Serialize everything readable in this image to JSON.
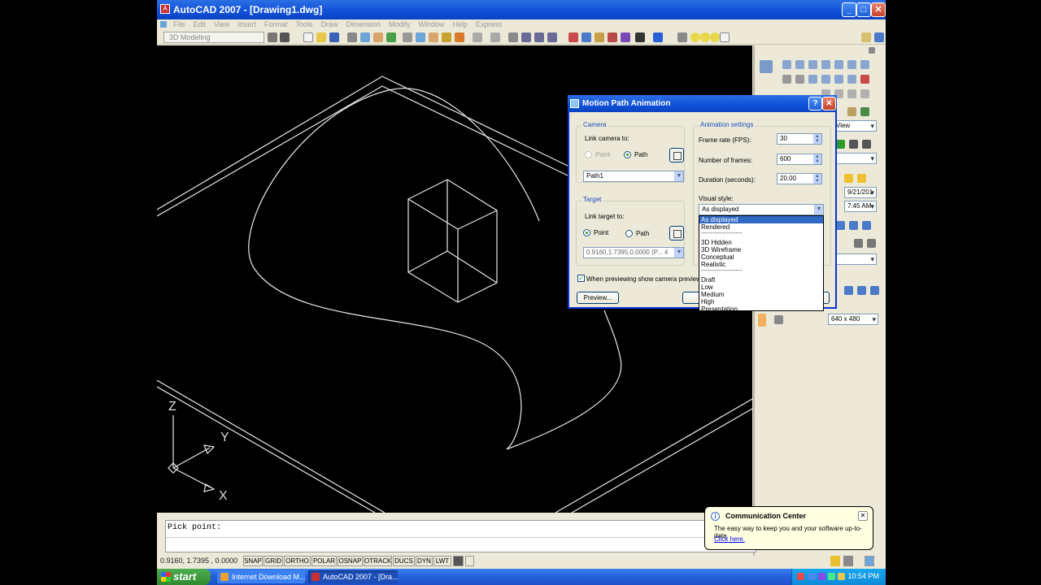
{
  "window": {
    "title": "AutoCAD 2007 - [Drawing1.dwg]"
  },
  "menubar": {
    "items": [
      "File",
      "Edit",
      "View",
      "Insert",
      "Format",
      "Tools",
      "Draw",
      "Dimension",
      "Modify",
      "Window",
      "Help",
      "Express"
    ]
  },
  "toolbar": {
    "workspace": "3D Modeling"
  },
  "viewport": {
    "ucs_x": "X",
    "ucs_y": "Y",
    "ucs_z": "Z"
  },
  "command_line": {
    "prompt": "Pick point:"
  },
  "status_bar": {
    "coordinates": "0.9160, 1.7395 , 0.0000",
    "toggles": [
      "SNAP",
      "GRID",
      "ORTHO",
      "POLAR",
      "OSNAP",
      "OTRACK",
      "DUCS",
      "DYN",
      "LWT"
    ]
  },
  "palette": {
    "view_select": "View",
    "date": "9/21/201",
    "time": "7:45 AM",
    "resolution": "640 x 480"
  },
  "dialog": {
    "title": "Motion Path Animation",
    "camera": {
      "group_label": "Camera",
      "link_label": "Link camera to:",
      "point_label": "Point",
      "path_label": "Path",
      "path_value": "Path1"
    },
    "target": {
      "group_label": "Target",
      "link_label": "Link target to:",
      "point_label": "Point",
      "path_label": "Path",
      "point_value": "0.9160,1.7395,0.0000 (P... 4"
    },
    "animation": {
      "group_label": "Animation settings",
      "frame_rate_label": "Frame rate (FPS):",
      "frame_rate": "30",
      "frames_label": "Number of frames:",
      "frames": "600",
      "duration_label": "Duration (seconds):",
      "duration": "20.00",
      "visual_style_label": "Visual style:",
      "visual_style": "As displayed",
      "visual_style_options": [
        "As displayed",
        "Rendered",
        "-------------------",
        "3D Hidden",
        "3D Wireframe",
        "Conceptual",
        "Realistic",
        "-------------------",
        "Draft",
        "Low",
        "Medium",
        "High",
        "Presentation"
      ]
    },
    "preview_checkbox_label": "When previewing show camera preview",
    "preview_button": "Preview..."
  },
  "balloon": {
    "title": "Communication Center",
    "body": "The easy way to keep you and your software up-to-date.",
    "link": "Click here."
  },
  "taskbar": {
    "start_label": "start",
    "tasks": [
      "Internet Download M...",
      "AutoCAD 2007 - [Dra..."
    ],
    "clock": "10:54 PM"
  }
}
